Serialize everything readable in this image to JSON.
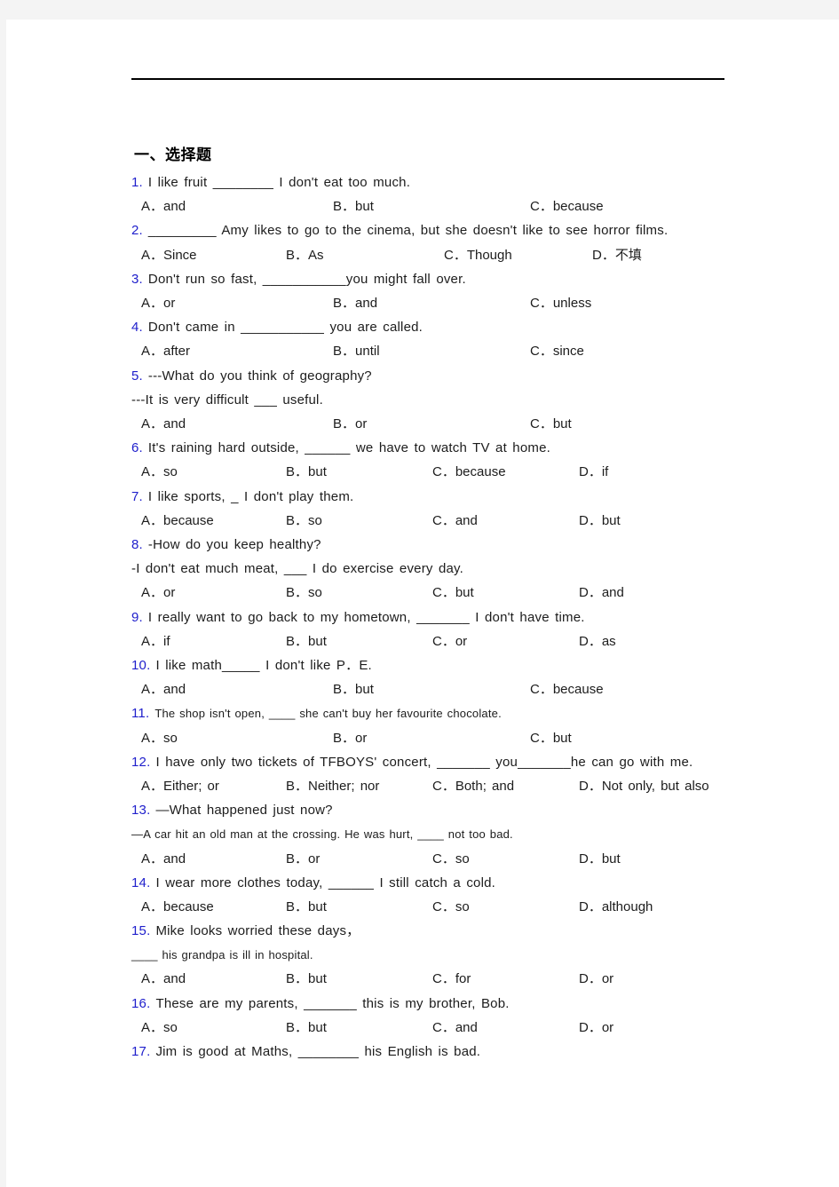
{
  "document": {
    "section_title": "一、选择题"
  },
  "questions": [
    {
      "num": "1.",
      "stem": "I like fruit ________ I don't eat too much.",
      "layout": "c3",
      "options": [
        "A．and",
        "B．but",
        "C．because"
      ]
    },
    {
      "num": "2.",
      "stem": "_________ Amy likes to go to the cinema, but she doesn't like to see horror films.",
      "layout": "w4",
      "options": [
        "A．Since",
        "B．As",
        "C．Though",
        "D．不填"
      ]
    },
    {
      "num": "3.",
      "stem": "Don't run so fast, ___________you might fall over.",
      "layout": "c3",
      "options": [
        "A．or",
        "B．and",
        "C．unless"
      ]
    },
    {
      "num": "4.",
      "stem": "Don't came in ___________ you are called.",
      "layout": "c3",
      "options": [
        "A．after",
        "B．until",
        "C．since"
      ]
    },
    {
      "num": "5.",
      "stem": "---What do you think of geography?",
      "stem2": "---It is very difficult ___ useful.",
      "layout": "c3",
      "options": [
        "A．and",
        "B．or",
        "C．but"
      ]
    },
    {
      "num": "6.",
      "stem": "It's raining hard outside, ______ we have to watch TV at home.",
      "layout": "c4",
      "options": [
        "A．so",
        "B．but",
        "C．because",
        "D．if"
      ]
    },
    {
      "num": "7.",
      "stem": "I like sports, _ I don't play them.",
      "layout": "c4",
      "options": [
        "A．because",
        "B．so",
        "C．and",
        "D．but"
      ]
    },
    {
      "num": "8.",
      "stem": "-How do you keep healthy?",
      "stem2": "-I don't eat much meat, ___  I do exercise every day.",
      "layout": "c4",
      "options": [
        "A．or",
        "B．so",
        "C．but",
        "D．and"
      ]
    },
    {
      "num": "9.",
      "stem": "I really want to go back to my hometown, _______ I don't have time.",
      "layout": "c4",
      "options": [
        "A．if",
        "B．but",
        "C．or",
        "D．as"
      ]
    },
    {
      "num": "10.",
      "stem": "I like math_____ I don't like P．E.",
      "layout": "c3",
      "options": [
        "A．and",
        "B．but",
        "C．because"
      ]
    },
    {
      "num": "11.",
      "stem": "The shop isn't open,      ____ she can't buy her favourite chocolate.",
      "layout": "c3",
      "options": [
        "A．so",
        "B．or",
        "C．but"
      ]
    },
    {
      "num": "12.",
      "stem": "I have only two tickets of TFBOYS' concert, _______ you_______he can go with me.",
      "layout": "c4",
      "options": [
        "A．Either; or",
        "B．Neither; nor",
        "C．Both; and",
        "D．Not only, but also"
      ]
    },
    {
      "num": "13.",
      "stem": "—What happened just now?",
      "stem2": "—A car hit an old man at the crossing. He was hurt,     ____ not too bad.",
      "layout": "c4",
      "options": [
        "A．and",
        "B．or",
        "C．so",
        "D．but"
      ]
    },
    {
      "num": "14.",
      "stem": "I wear more clothes today, ______ I still catch a cold.",
      "layout": "c4",
      "options": [
        "A．because",
        "B．but",
        "C．so",
        "D．although"
      ]
    },
    {
      "num": "15.",
      "stem": "Mike looks worried these days，",
      "stem2": "____   his grandpa is ill in hospital.",
      "layout": "c4",
      "options": [
        "A．and",
        "B．but",
        "C．for",
        "D．or"
      ]
    },
    {
      "num": "16.",
      "stem": "These are my parents, _______ this is my brother, Bob.",
      "layout": "c4",
      "options": [
        "A．so",
        "B．but",
        "C．and",
        "D．or"
      ]
    },
    {
      "num": "17.",
      "stem": "Jim is good at Maths, ________ his English is bad.",
      "layout": "none",
      "options": []
    }
  ],
  "colors": {
    "number": "#2020cc",
    "text": "#1c1c1c",
    "page_background": "#ffffff",
    "canvas_background": "#f4f4f4",
    "rule": "#000000"
  }
}
